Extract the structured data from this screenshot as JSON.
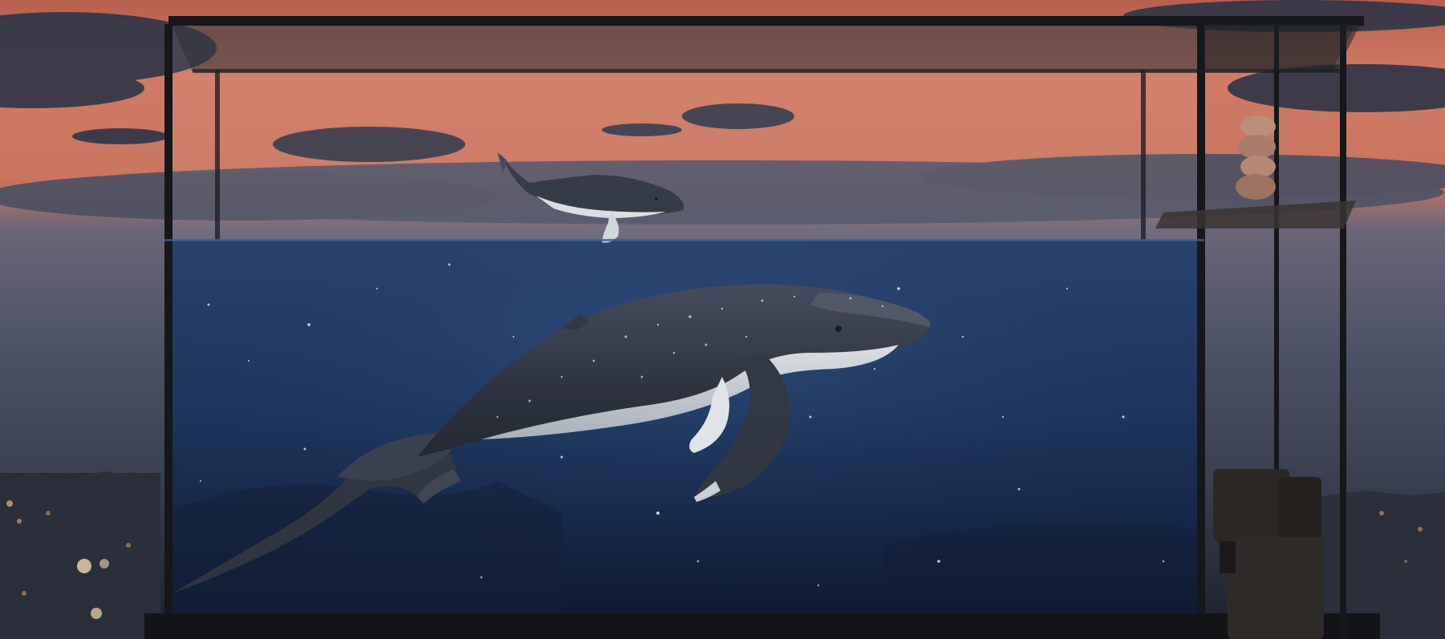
{
  "scene": {
    "description_colors": {
      "sky_top": "#c46a58",
      "sky_mid": "#d9846a",
      "sky_low": "#5a5f72",
      "cloud_dark": "#2c3346",
      "water_top": "#1d3a66",
      "water_bottom": "#0b1730",
      "frame": "#1a1c21",
      "whale_body": "#2f3644",
      "whale_belly": "#d7dbe0",
      "city_light": "#f2b27a"
    },
    "icons": {
      "large_whale": "humpback-whale",
      "small_whale": "humpback-calf",
      "vase": "stacked-stone-vase",
      "speaker": "speaker-block"
    }
  }
}
